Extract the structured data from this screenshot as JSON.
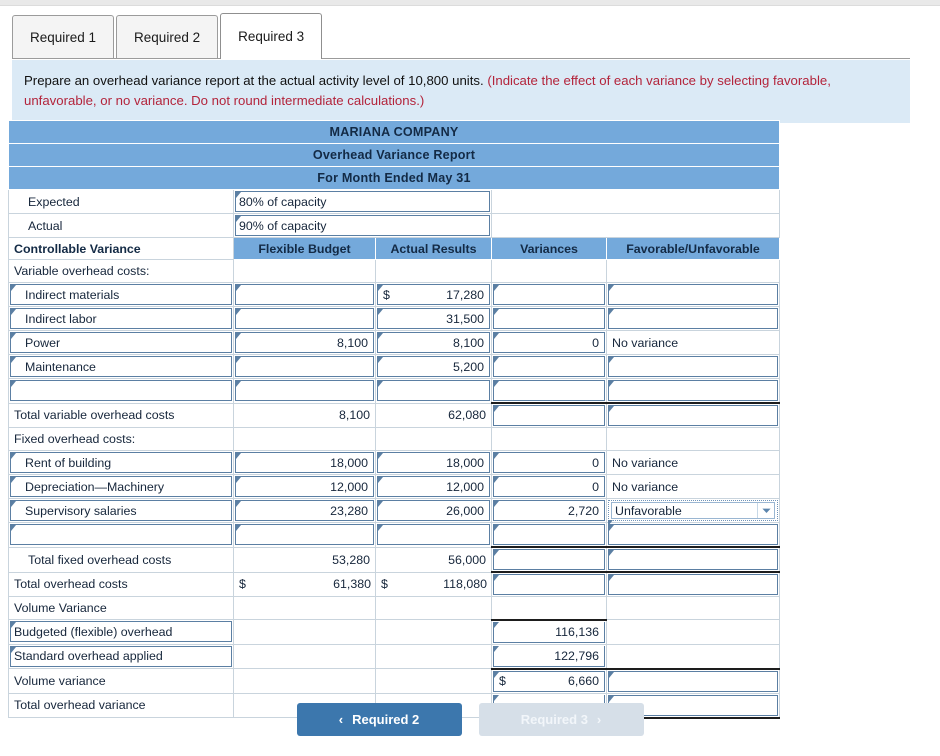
{
  "tabs": [
    {
      "label": "Required 1",
      "active": false
    },
    {
      "label": "Required 2",
      "active": false
    },
    {
      "label": "Required 3",
      "active": true
    }
  ],
  "instruction": {
    "black_text": "Prepare an overhead variance report at the actual activity level of 10,800 units.",
    "red_text": "(Indicate the effect of each variance by selecting favorable, unfavorable, or no variance. Do not round intermediate calculations.)"
  },
  "report": {
    "title_lines": [
      "MARIANA COMPANY",
      "Overhead Variance Report",
      "For Month Ended May 31"
    ],
    "capacity_rows": [
      {
        "label": "Expected",
        "value": "80% of capacity"
      },
      {
        "label": "Actual",
        "value": "90% of capacity"
      }
    ],
    "column_headers": [
      "Controllable Variance",
      "Flexible Budget",
      "Actual Results",
      "Variances",
      "Favorable/Unfavorable"
    ],
    "section_variable_label": "Variable overhead costs:",
    "variable_rows": [
      {
        "label": "Indirect materials",
        "flexible": "",
        "flexible_cur": "",
        "actual": "17,280",
        "actual_cur": "$",
        "variance": "",
        "fu": ""
      },
      {
        "label": "Indirect labor",
        "flexible": "",
        "flexible_cur": "",
        "actual": "31,500",
        "actual_cur": "",
        "variance": "",
        "fu": ""
      },
      {
        "label": "Power",
        "flexible": "8,100",
        "flexible_cur": "",
        "actual": "8,100",
        "actual_cur": "",
        "variance": "0",
        "fu": "No variance"
      },
      {
        "label": "Maintenance",
        "flexible": "",
        "flexible_cur": "",
        "actual": "5,200",
        "actual_cur": "",
        "variance": "",
        "fu": ""
      },
      {
        "label": "",
        "flexible": "",
        "flexible_cur": "",
        "actual": "",
        "actual_cur": "",
        "variance": "",
        "fu": ""
      }
    ],
    "variable_total": {
      "label": "Total variable overhead costs",
      "flexible": "8,100",
      "flexible_cur": "",
      "actual": "62,080",
      "actual_cur": "",
      "variance": "",
      "fu": ""
    },
    "section_fixed_label": "Fixed overhead costs:",
    "fixed_rows": [
      {
        "label": "Rent of building",
        "flexible": "18,000",
        "actual": "18,000",
        "variance": "0",
        "fu": "No variance",
        "fu_is_select": false
      },
      {
        "label": "Depreciation—Machinery",
        "flexible": "12,000",
        "actual": "12,000",
        "variance": "0",
        "fu": "No variance",
        "fu_is_select": false
      },
      {
        "label": "Supervisory salaries",
        "flexible": "23,280",
        "actual": "26,000",
        "variance": "2,720",
        "fu": "Unfavorable",
        "fu_is_select": true
      },
      {
        "label": "",
        "flexible": "",
        "actual": "",
        "variance": "",
        "fu": "",
        "fu_is_select": false
      }
    ],
    "fixed_total": {
      "label": "Total fixed overhead costs",
      "flexible": "53,280",
      "actual": "56,000",
      "variance": "",
      "fu": ""
    },
    "grand_total": {
      "label": "Total overhead costs",
      "flexible": "61,380",
      "flexible_cur": "$",
      "actual": "118,080",
      "actual_cur": "$",
      "variance": "",
      "fu": ""
    },
    "volume_section_label": "Volume Variance",
    "volume_rows": [
      {
        "label": "Budgeted (flexible) overhead",
        "variance": "116,136",
        "variance_cur": "",
        "label_boxed": true,
        "ruled": false,
        "fu_box": false
      },
      {
        "label": "Standard overhead applied",
        "variance": "122,796",
        "variance_cur": "",
        "label_boxed": true,
        "ruled": false,
        "fu_box": false
      },
      {
        "label": "Volume variance",
        "variance": "6,660",
        "variance_cur": "$",
        "label_boxed": false,
        "ruled": true,
        "fu_box": true
      },
      {
        "label": "Total overhead variance",
        "variance": "",
        "variance_cur": "",
        "label_boxed": false,
        "ruled": false,
        "fu_box": true
      }
    ]
  },
  "nav": {
    "prev_label": "Required 2",
    "next_label": "Required 3",
    "prev_chevron": "‹",
    "next_chevron": "›"
  },
  "colors": {
    "header_blue": "#74a9db",
    "banner_blue": "#dbeaf6",
    "instruction_red": "#b3243b",
    "cell_border_blue": "#5b7fa3",
    "nav_active": "#3c77ad",
    "nav_disabled": "#d6dfe8"
  }
}
